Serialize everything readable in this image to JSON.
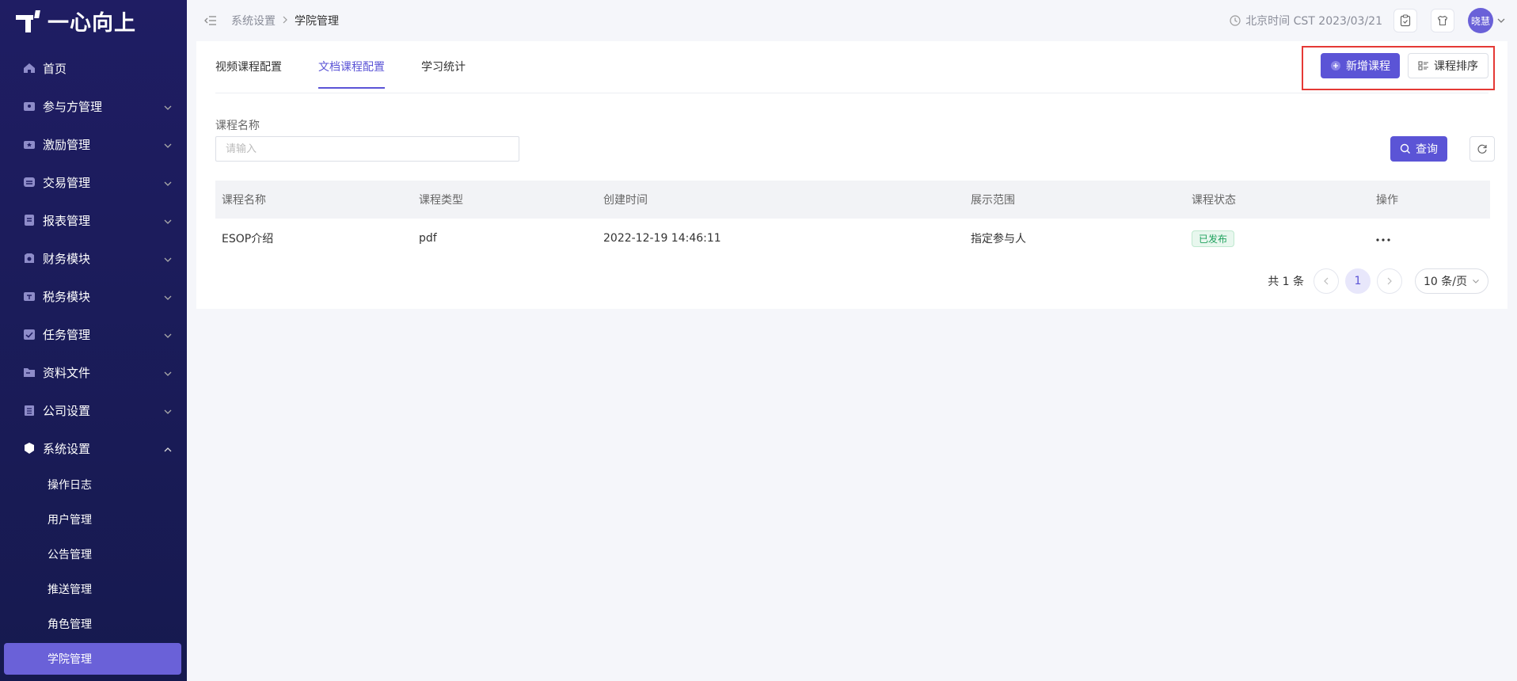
{
  "brand": {
    "name": "一心向上"
  },
  "sidebar": {
    "items": [
      {
        "label": "首页",
        "icon": "home-icon",
        "expandable": false
      },
      {
        "label": "参与方管理",
        "icon": "participant-icon",
        "expandable": true
      },
      {
        "label": "激励管理",
        "icon": "incentive-icon",
        "expandable": true
      },
      {
        "label": "交易管理",
        "icon": "trade-icon",
        "expandable": true
      },
      {
        "label": "报表管理",
        "icon": "report-icon",
        "expandable": true
      },
      {
        "label": "财务模块",
        "icon": "finance-icon",
        "expandable": true
      },
      {
        "label": "税务模块",
        "icon": "tax-icon",
        "expandable": true
      },
      {
        "label": "任务管理",
        "icon": "task-icon",
        "expandable": true
      },
      {
        "label": "资料文件",
        "icon": "folder-icon",
        "expandable": true
      },
      {
        "label": "公司设置",
        "icon": "company-icon",
        "expandable": true
      },
      {
        "label": "系统设置",
        "icon": "system-icon",
        "expandable": true,
        "expanded": true
      }
    ],
    "sub_items": [
      {
        "label": "操作日志",
        "active": false
      },
      {
        "label": "用户管理",
        "active": false
      },
      {
        "label": "公告管理",
        "active": false
      },
      {
        "label": "推送管理",
        "active": false
      },
      {
        "label": "角色管理",
        "active": false
      },
      {
        "label": "学院管理",
        "active": true
      }
    ]
  },
  "topbar": {
    "breadcrumb": [
      "系统设置",
      "学院管理"
    ],
    "time_text": "北京时间 CST 2023/03/21",
    "avatar_text": "晓慧"
  },
  "tabs": [
    {
      "label": "视频课程配置",
      "active": false
    },
    {
      "label": "文档课程配置",
      "active": true
    },
    {
      "label": "学习统计",
      "active": false
    }
  ],
  "actions": {
    "add_label": "新增课程",
    "sort_label": "课程排序"
  },
  "filter": {
    "label": "课程名称",
    "placeholder": "请输入",
    "value": "",
    "search_label": "查询"
  },
  "table": {
    "headers": [
      "课程名称",
      "课程类型",
      "创建时间",
      "展示范围",
      "课程状态",
      "操作"
    ],
    "rows": [
      {
        "name": "ESOP介绍",
        "type": "pdf",
        "created": "2022-12-19 14:46:11",
        "scope": "指定参与人",
        "status": "已发布"
      }
    ]
  },
  "pagination": {
    "total_text": "共 1 条",
    "current_page": "1",
    "page_size": "10 条/页"
  },
  "colors": {
    "primary": "#5b54d6",
    "sidebar_bg": "#1f1d63",
    "success": "#1fa15d",
    "highlight": "#e53935"
  }
}
